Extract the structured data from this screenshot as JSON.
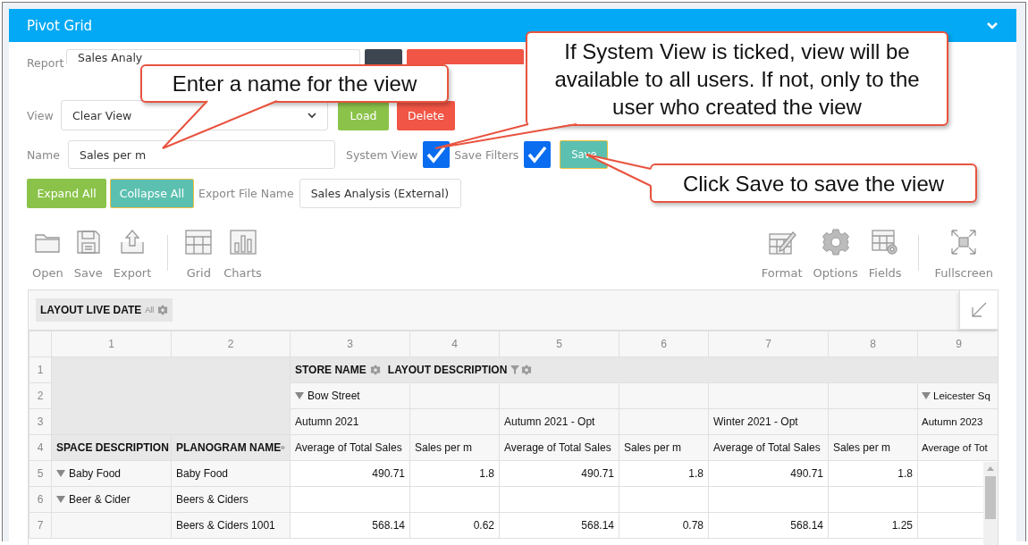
{
  "panel": {
    "title": "Pivot Grid"
  },
  "form": {
    "report_label": "Report",
    "report_value": "Sales Analy",
    "view_label": "View",
    "view_value": "Clear View",
    "load_button": "Load",
    "delete_button": "Delete",
    "name_label": "Name",
    "name_value": "Sales per m",
    "system_view": {
      "label": "System View",
      "checked": true
    },
    "save_filters": {
      "label": "Save Filters",
      "checked": true
    },
    "save_button": "Save",
    "expand_button": "Expand All",
    "collapse_button": "Collapse All",
    "export_label": "Export File Name",
    "export_value": "Sales Analysis (External)"
  },
  "toolbar_left": [
    [
      {
        "label": "Open"
      },
      {
        "label": "Save"
      },
      {
        "label": "Export"
      }
    ],
    [
      {
        "label": "Grid"
      },
      {
        "label": "Charts"
      }
    ]
  ],
  "toolbar_right": [
    [
      {
        "label": "Format"
      },
      {
        "label": "Options"
      },
      {
        "label": "Fields"
      }
    ],
    [
      {
        "label": "Fullscreen"
      }
    ]
  ],
  "pivot": {
    "filter_field": {
      "label": "LAYOUT LIVE DATE",
      "badge": "All"
    },
    "column_numbers": [
      "1",
      "2",
      "3",
      "4",
      "5",
      "6",
      "7",
      "8",
      "9"
    ],
    "row_numbers": [
      "1",
      "2",
      "3",
      "4",
      "5",
      "6",
      "7"
    ],
    "column_fields": [
      {
        "label": "STORE NAME",
        "filtered": false
      },
      {
        "label": "LAYOUT DESCRIPTION",
        "filtered": true
      }
    ],
    "stores": [
      {
        "text": "Bow Street",
        "expanded": true,
        "layouts": [
          {
            "text": "Autumn 2021",
            "measures": [
              "Average of Total Sales",
              "Sales per m"
            ]
          },
          {
            "text": "Autumn 2021 - Opt",
            "measures": [
              "Average of Total Sales",
              "Sales per m"
            ]
          },
          {
            "text": "Winter 2021 - Opt",
            "measures": [
              "Average of Total Sales",
              "Sales per m"
            ]
          }
        ]
      },
      {
        "text": "Leicester Sq",
        "expanded": true,
        "layouts": [
          {
            "text": "Autumn 2023",
            "measures": [
              "Average of Tot"
            ]
          }
        ]
      }
    ],
    "row_fields": [
      {
        "label": "SPACE DESCRIPTION"
      },
      {
        "label": "PLANOGRAM NAME"
      }
    ],
    "rows": [
      {
        "space": {
          "text": "Baby Food",
          "expanded": true
        },
        "planogram": "Baby Food",
        "values": [
          "490.71",
          "1.8",
          "490.71",
          "1.8",
          "490.71",
          "1.8"
        ]
      },
      {
        "space": {
          "text": "Beer & Cider",
          "expanded": true
        },
        "planogram": "Beers & Ciders"
      },
      {
        "planogram": "Beers & Ciders 1001",
        "values": [
          "568.14",
          "0.62",
          "568.14",
          "0.78",
          "568.14",
          "1.25"
        ]
      }
    ]
  },
  "callouts": [
    {
      "text": "Enter a name for the view"
    },
    {
      "text": "If System View is ticked, view will be available to all users. If not, only to the user who created the view"
    },
    {
      "text": "Click Save to save the view"
    }
  ]
}
